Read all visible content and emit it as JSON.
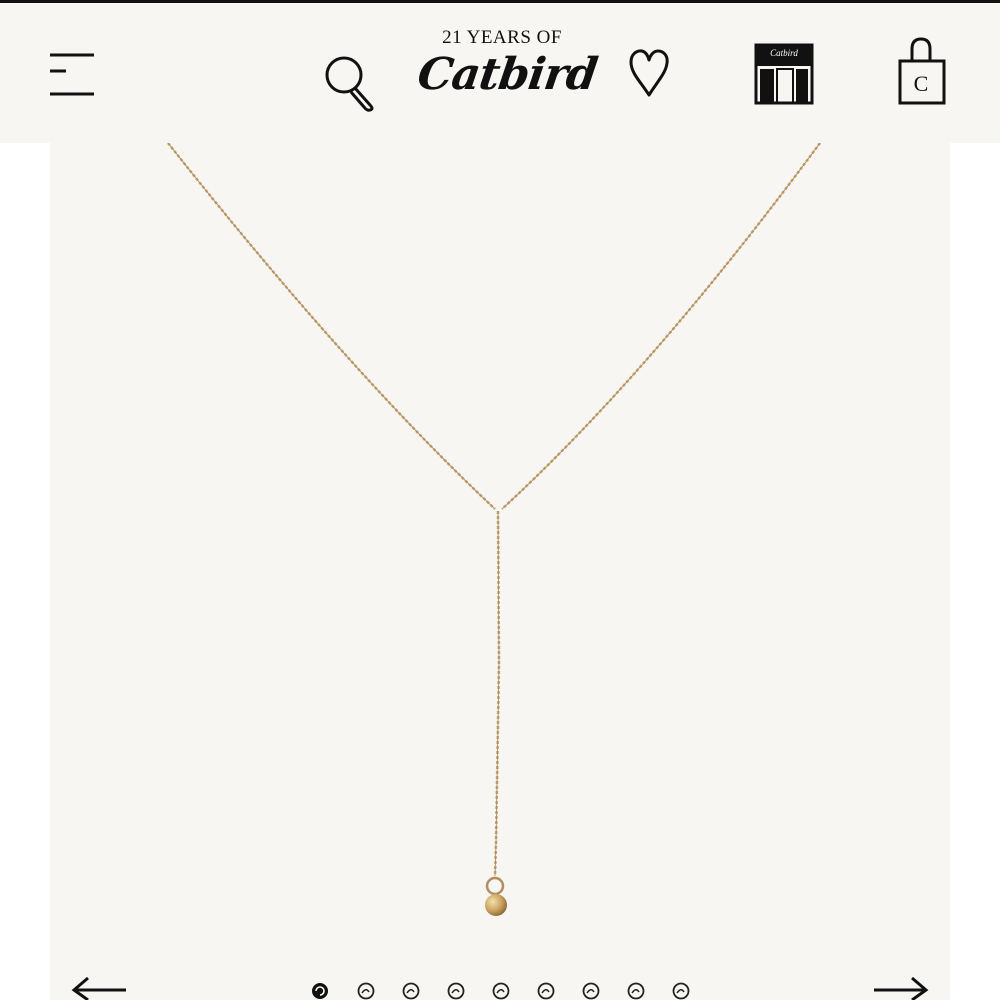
{
  "header": {
    "logo_line1": "21 YEARS OF",
    "logo_brand": "Catbird",
    "store_sign": "Catbird",
    "bag_letter": "C",
    "icons": [
      "menu-icon",
      "search-icon",
      "heart-icon",
      "store-icon",
      "shopping-bag-icon"
    ],
    "background": "#f7f6f3"
  },
  "gallery": {
    "background": "#f7f6f3",
    "chain_color": "#c9a977",
    "slide_count": 9,
    "active_slide": 1,
    "prev_icon": "arrow-left-icon",
    "next_icon": "arrow-right-icon"
  }
}
